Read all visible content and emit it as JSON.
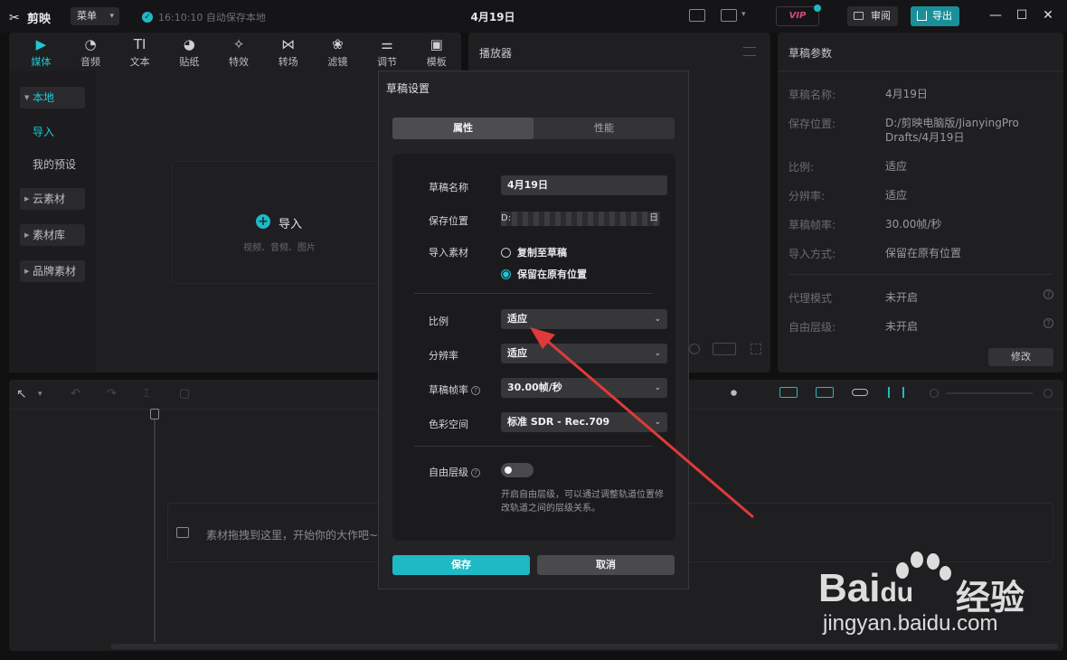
{
  "titlebar": {
    "app_name": "剪映",
    "menu_label": "菜单",
    "autosave_text": "16:10:10 自动保存本地",
    "project_title": "4月19日",
    "vip_label": "VIP",
    "review_label": "审阅",
    "export_label": "导出"
  },
  "toolbar": {
    "items": [
      {
        "label": "媒体",
        "icon": "media-icon"
      },
      {
        "label": "音频",
        "icon": "audio-icon"
      },
      {
        "label": "文本",
        "icon": "text-icon"
      },
      {
        "label": "贴纸",
        "icon": "sticker-icon"
      },
      {
        "label": "特效",
        "icon": "effects-icon"
      },
      {
        "label": "转场",
        "icon": "transition-icon"
      },
      {
        "label": "滤镜",
        "icon": "filter-icon"
      },
      {
        "label": "调节",
        "icon": "adjust-icon"
      },
      {
        "label": "模板",
        "icon": "template-icon"
      }
    ],
    "active_index": 0
  },
  "sidebar": {
    "local": "本地",
    "import": "导入",
    "presets": "我的预设",
    "cloud": "云素材",
    "library": "素材库",
    "brand": "品牌素材"
  },
  "media": {
    "import_label": "导入",
    "import_hint": "视频、音频、图片"
  },
  "player": {
    "title": "播放器"
  },
  "draft_params": {
    "title": "草稿参数",
    "rows": [
      {
        "label": "草稿名称:",
        "value": "4月19日"
      },
      {
        "label": "保存位置:",
        "value": "D:/剪映电脑版/JianyingPro Drafts/4月19日"
      },
      {
        "label": "比例:",
        "value": "适应"
      },
      {
        "label": "分辨率:",
        "value": "适应"
      },
      {
        "label": "草稿帧率:",
        "value": "30.00帧/秒"
      },
      {
        "label": "导入方式:",
        "value": "保留在原有位置"
      },
      {
        "label": "代理模式",
        "value": "未开启"
      },
      {
        "label": "自由层级:",
        "value": "未开启"
      }
    ],
    "modify_label": "修改"
  },
  "timeline": {
    "hint": "素材拖拽到这里，开始你的大作吧~"
  },
  "dialog": {
    "title": "草稿设置",
    "tab_properties": "属性",
    "tab_performance": "性能",
    "name_label": "草稿名称",
    "name_value": "4月19日",
    "location_label": "保存位置",
    "location_value": "D:",
    "location_suffix": "日",
    "import_label": "导入素材",
    "import_copy": "复制至草稿",
    "import_keep": "保留在原有位置",
    "ratio_label": "比例",
    "ratio_value": "适应",
    "resolution_label": "分辨率",
    "resolution_value": "适应",
    "fps_label": "草稿帧率",
    "fps_value": "30.00帧/秒",
    "color_label": "色彩空间",
    "color_value": "标准 SDR - Rec.709",
    "free_layer_label": "自由层级",
    "free_layer_desc": "开启自由层级，可以通过调整轨道位置修改轨道之间的层级关系。",
    "save_label": "保存",
    "cancel_label": "取消"
  },
  "watermark": {
    "brand": "Bai",
    "brand_du": "du",
    "jingyan": "经验",
    "url": "jingyan.baidu.com"
  },
  "colors": {
    "accent": "#1fb8c5",
    "background": "#101011",
    "panel": "#1f1f21",
    "arrow": "#e03a3a"
  }
}
